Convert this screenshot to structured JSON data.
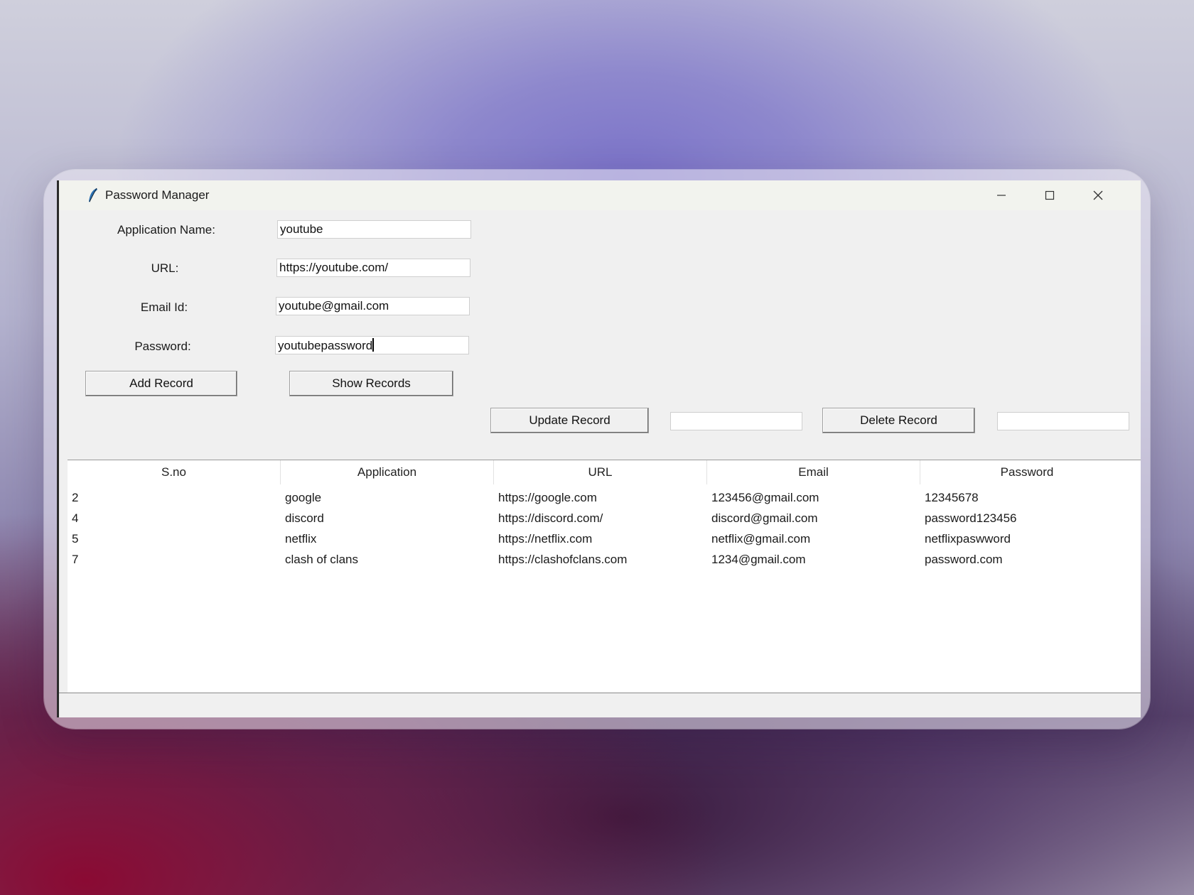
{
  "window": {
    "title": "Password Manager",
    "icon": "feather-icon"
  },
  "form": {
    "app_name_label": "Application Name:",
    "app_name_value": "youtube",
    "url_label": "URL:",
    "url_value": "https://youtube.com/",
    "email_label": "Email Id:",
    "email_value": "youtube@gmail.com",
    "password_label": "Password:",
    "password_value": "youtubepassword"
  },
  "buttons": {
    "add": "Add Record",
    "show": "Show Records",
    "update": "Update Record",
    "delete": "Delete Record"
  },
  "side_fields": {
    "update_value": "",
    "delete_value": ""
  },
  "table": {
    "columns": [
      "S.no",
      "Application",
      "URL",
      "Email",
      "Password"
    ],
    "rows": [
      [
        "2",
        "google",
        "https://google.com",
        "123456@gmail.com",
        "12345678"
      ],
      [
        "4",
        "discord",
        "https://discord.com/",
        "discord@gmail.com",
        "password123456"
      ],
      [
        "5",
        "netflix",
        "https://netflix.com",
        "netflix@gmail.com",
        "netflixpaswword"
      ],
      [
        "7",
        "clash of clans",
        "https://clashofclans.com",
        "1234@gmail.com",
        "password.com"
      ]
    ]
  }
}
